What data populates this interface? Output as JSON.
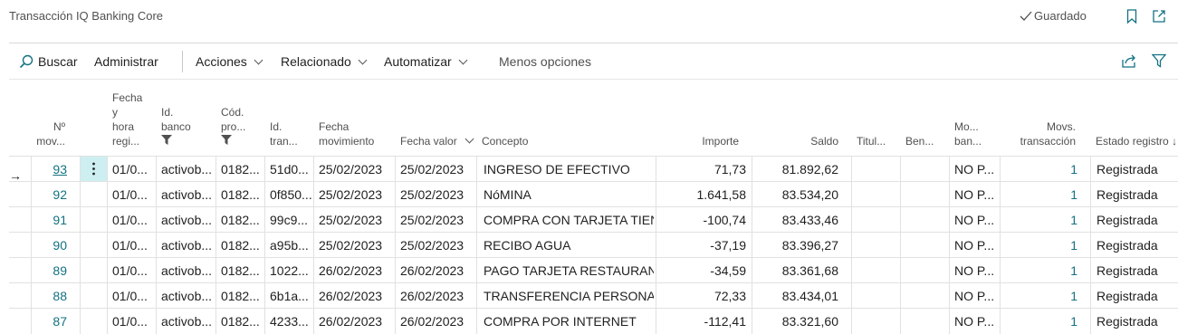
{
  "page": {
    "title": "Transacción IQ Banking Core",
    "saved_label": "Guardado"
  },
  "actionbar": {
    "search": "Buscar",
    "manage": "Administrar",
    "actions": "Acciones",
    "related": "Relacionado",
    "automate": "Automatizar",
    "fewer": "Menos opciones"
  },
  "columns": {
    "no_mov": [
      "Nº",
      "mov..."
    ],
    "fecha_registro": [
      "Fecha",
      "y",
      "hora",
      "regi..."
    ],
    "id_banco": [
      "Id.",
      "banco"
    ],
    "cod_pro": [
      "Cód.",
      "pro..."
    ],
    "id_tran": [
      "Id.",
      "tran..."
    ],
    "fecha_mov": [
      "Fecha",
      "movimiento"
    ],
    "fecha_valor": "Fecha valor",
    "concepto": "Concepto",
    "importe": "Importe",
    "saldo": "Saldo",
    "titular": "Titul...",
    "beneficiario": "Ben...",
    "mov_banco": [
      "Mo...",
      "ban..."
    ],
    "movs_transaccion": [
      "Movs.",
      "transacción"
    ],
    "estado": "Estado registro"
  },
  "rows": [
    {
      "no": "93",
      "fecha_reg": "01/0...",
      "banco": "activob...",
      "cod": "0182...",
      "tran": "51d0...",
      "fecha_mov": "25/02/2023",
      "fecha_valor": "25/02/2023",
      "concepto": "INGRESO DE EFECTIVO",
      "importe": "71,73",
      "saldo": "81.892,62",
      "titular": "",
      "ben": "",
      "mov_banco": "NO P...",
      "movs": "1",
      "estado": "Registrada"
    },
    {
      "no": "92",
      "fecha_reg": "01/0...",
      "banco": "activob...",
      "cod": "0182...",
      "tran": "0f850...",
      "fecha_mov": "25/02/2023",
      "fecha_valor": "25/02/2023",
      "concepto": "NóMINA",
      "importe": "1.641,58",
      "saldo": "83.534,20",
      "titular": "",
      "ben": "",
      "mov_banco": "NO P...",
      "movs": "1",
      "estado": "Registrada"
    },
    {
      "no": "91",
      "fecha_reg": "01/0...",
      "banco": "activob...",
      "cod": "0182...",
      "tran": "99c9...",
      "fecha_mov": "25/02/2023",
      "fecha_valor": "25/02/2023",
      "concepto": "COMPRA CON TARJETA TIEN...",
      "importe": "-100,74",
      "saldo": "83.433,46",
      "titular": "",
      "ben": "",
      "mov_banco": "NO P...",
      "movs": "1",
      "estado": "Registrada"
    },
    {
      "no": "90",
      "fecha_reg": "01/0...",
      "banco": "activob...",
      "cod": "0182...",
      "tran": "a95b...",
      "fecha_mov": "25/02/2023",
      "fecha_valor": "25/02/2023",
      "concepto": "RECIBO AGUA",
      "importe": "-37,19",
      "saldo": "83.396,27",
      "titular": "",
      "ben": "",
      "mov_banco": "NO P...",
      "movs": "1",
      "estado": "Registrada"
    },
    {
      "no": "89",
      "fecha_reg": "01/0...",
      "banco": "activob...",
      "cod": "0182...",
      "tran": "1022...",
      "fecha_mov": "26/02/2023",
      "fecha_valor": "26/02/2023",
      "concepto": "PAGO TARJETA RESTAURANTE",
      "importe": "-34,59",
      "saldo": "83.361,68",
      "titular": "",
      "ben": "",
      "mov_banco": "NO P...",
      "movs": "1",
      "estado": "Registrada"
    },
    {
      "no": "88",
      "fecha_reg": "01/0...",
      "banco": "activob...",
      "cod": "0182...",
      "tran": "6b1a...",
      "fecha_mov": "26/02/2023",
      "fecha_valor": "26/02/2023",
      "concepto": "TRANSFERENCIA PERSONAL",
      "importe": "72,33",
      "saldo": "83.434,01",
      "titular": "",
      "ben": "",
      "mov_banco": "NO P...",
      "movs": "1",
      "estado": "Registrada"
    },
    {
      "no": "87",
      "fecha_reg": "01/0...",
      "banco": "activob...",
      "cod": "0182...",
      "tran": "4233...",
      "fecha_mov": "26/02/2023",
      "fecha_valor": "26/02/2023",
      "concepto": "COMPRA POR INTERNET",
      "importe": "-112,41",
      "saldo": "83.321,60",
      "titular": "",
      "ben": "",
      "mov_banco": "NO P...",
      "movs": "1",
      "estado": "Registrada"
    }
  ],
  "icons": {
    "saved": "checkmark-icon",
    "bookmark": "bookmark-icon",
    "open_new": "open-in-new-window-icon",
    "search": "search-icon",
    "share": "share-icon",
    "filter": "filter-icon",
    "row_arrow": "arrow-right-icon",
    "row_menu": "more-vertical-icon"
  },
  "colors": {
    "link": "#137282",
    "selected_cell": "#cdeff1"
  }
}
